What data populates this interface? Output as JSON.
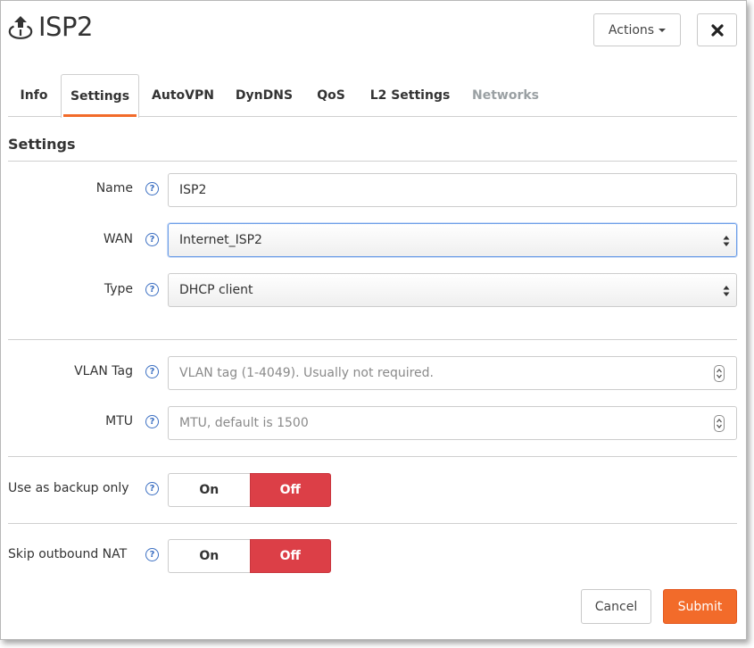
{
  "header": {
    "title": "ISP2",
    "title_icon": "uplink-icon",
    "actions_label": "Actions",
    "close_icon": "close-icon"
  },
  "tabs": [
    {
      "label": "Info",
      "active": false,
      "disabled": false
    },
    {
      "label": "Settings",
      "active": true,
      "disabled": false
    },
    {
      "label": "AutoVPN",
      "active": false,
      "disabled": false
    },
    {
      "label": "DynDNS",
      "active": false,
      "disabled": false
    },
    {
      "label": "QoS",
      "active": false,
      "disabled": false
    },
    {
      "label": "L2 Settings",
      "active": false,
      "disabled": false
    },
    {
      "label": "Networks",
      "active": false,
      "disabled": true
    }
  ],
  "section": {
    "title": "Settings"
  },
  "form": {
    "name": {
      "label": "Name",
      "value": "ISP2"
    },
    "wan": {
      "label": "WAN",
      "value": "Internet_ISP2"
    },
    "type": {
      "label": "Type",
      "value": "DHCP client"
    },
    "vlan_tag": {
      "label": "VLAN Tag",
      "value": "",
      "placeholder": "VLAN tag (1-4049). Usually not required."
    },
    "mtu": {
      "label": "MTU",
      "value": "",
      "placeholder": "MTU, default is 1500"
    },
    "backup_only": {
      "label": "Use as backup only",
      "on_label": "On",
      "off_label": "Off",
      "selected": "Off"
    },
    "skip_nat": {
      "label": "Skip outbound NAT",
      "on_label": "On",
      "off_label": "Off",
      "selected": "Off"
    }
  },
  "help_glyph": "?",
  "footer": {
    "cancel_label": "Cancel",
    "submit_label": "Submit"
  },
  "colors": {
    "accent": "#f26b2a",
    "toggle_off": "#dc3f47",
    "help_icon": "#3b6fc2",
    "disabled_tab": "#9aa0a3"
  }
}
